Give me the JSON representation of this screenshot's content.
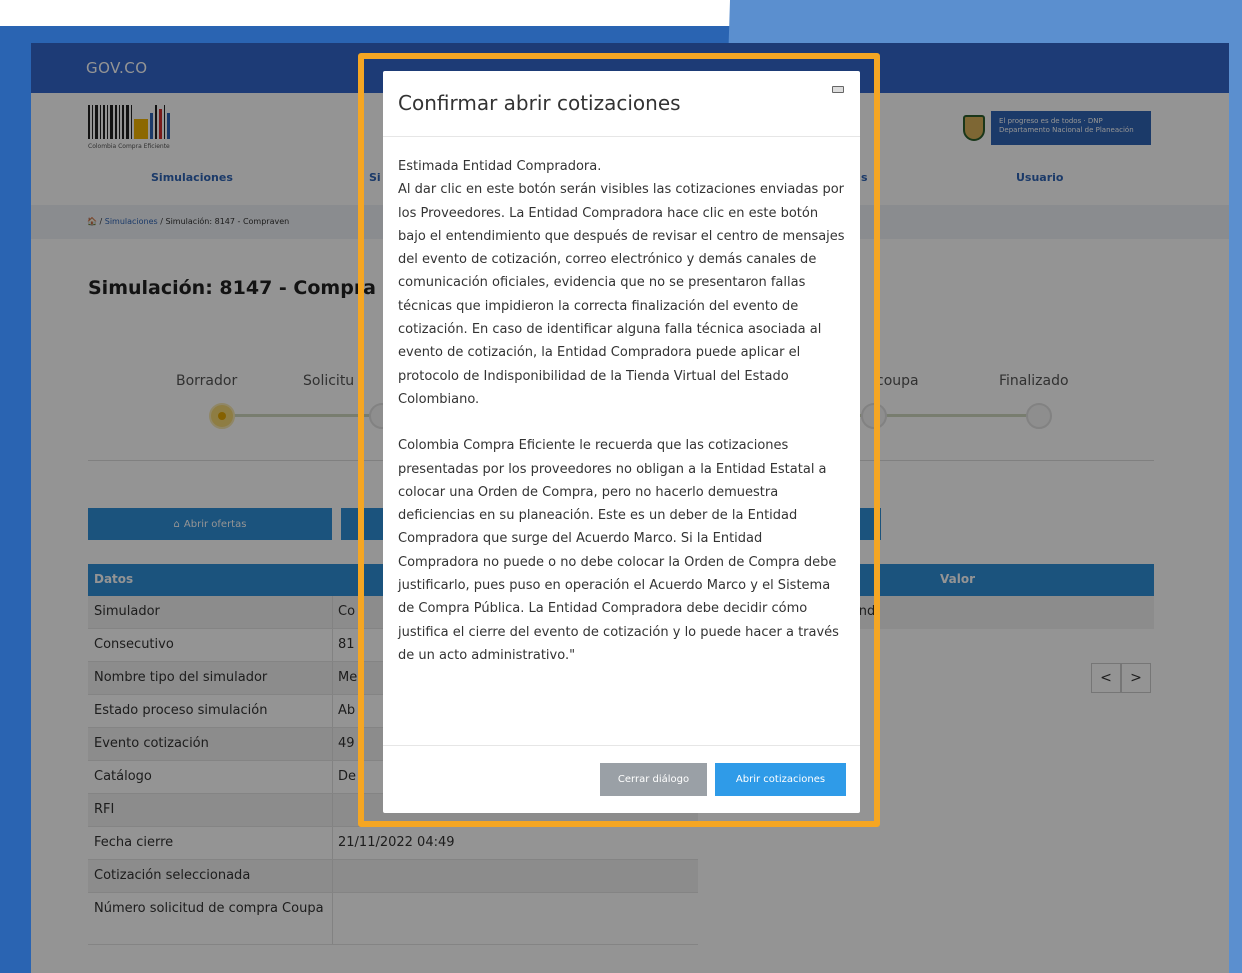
{
  "gov_bar": {
    "logo": "GOV.CO"
  },
  "brand": {
    "name": "Colombia Compra Eficiente"
  },
  "dnp": {
    "text": "El progreso es de todos · DNP Departamento Nacional de Planeación"
  },
  "nav": {
    "items": [
      "Simulaciones",
      "Si",
      "s",
      "Usuario"
    ]
  },
  "breadcrumb": {
    "home": "🏠",
    "link": "Simulaciones",
    "rest": " / Simulación: 8147 - Compraven",
    "sep": " / "
  },
  "page_title": "Simulación: 8147 - Compra",
  "steps": {
    "labels": [
      "Borrador",
      "Solicitu",
      "coupa",
      "Finalizado"
    ]
  },
  "buttons": {
    "abrir_ofertas": "Abrir ofertas"
  },
  "table": {
    "header_datos": "Datos",
    "header_valor": "Valor",
    "no_records": "found",
    "rows": [
      {
        "label": "Simulador",
        "value": "Co"
      },
      {
        "label": "Consecutivo",
        "value": "81"
      },
      {
        "label": "Nombre tipo del simulador",
        "value": "Me"
      },
      {
        "label": "Estado proceso simulación",
        "value": "Ab"
      },
      {
        "label": "Evento cotización",
        "value": "49"
      },
      {
        "label": "Catálogo",
        "value": "De"
      },
      {
        "label": "RFI",
        "value": ""
      },
      {
        "label": "Fecha cierre",
        "value": "21/11/2022 04:49"
      },
      {
        "label": "Cotización seleccionada",
        "value": ""
      },
      {
        "label": "Número solicitud de compra Coupa",
        "value": ""
      }
    ],
    "pager_prev": "<",
    "pager_next": ">"
  },
  "modal": {
    "title": "Confirmar abrir cotizaciones",
    "paragraph1": "Estimada Entidad Compradora.\nAl dar clic en este botón serán visibles las cotizaciones enviadas por los Proveedores. La Entidad Compradora hace clic en este botón bajo el entendimiento que después de revisar el centro de mensajes del evento de cotización, correo electrónico y demás canales de comunicación oficiales, evidencia que no se presentaron fallas técnicas que impidieron la correcta finalización del evento de cotización. En caso de identificar alguna falla técnica asociada al evento de cotización, la Entidad Compradora puede aplicar el protocolo de Indisponibilidad de la Tienda Virtual del Estado Colombiano.",
    "paragraph2": "Colombia Compra Eficiente le recuerda que las cotizaciones presentadas por los proveedores no obligan a la Entidad Estatal a colocar una Orden de Compra, pero no hacerlo demuestra deficiencias en su planeación. Este es un deber de la Entidad Compradora que surge del Acuerdo Marco. Si la Entidad Compradora no puede o no debe colocar la Orden de Compra debe justificarlo, pues puso en operación el Acuerdo Marco y el Sistema de Compra Pública. La Entidad Compradora debe decidir cómo justifica el cierre del evento de cotización y lo puede hacer a través de un acto administrativo.\"",
    "btn_close": "Cerrar diálogo",
    "btn_open": "Abrir cotizaciones"
  },
  "colors": {
    "highlight": "#f5a623",
    "primary": "#2f9be8",
    "gov_blue": "#3366cc"
  }
}
